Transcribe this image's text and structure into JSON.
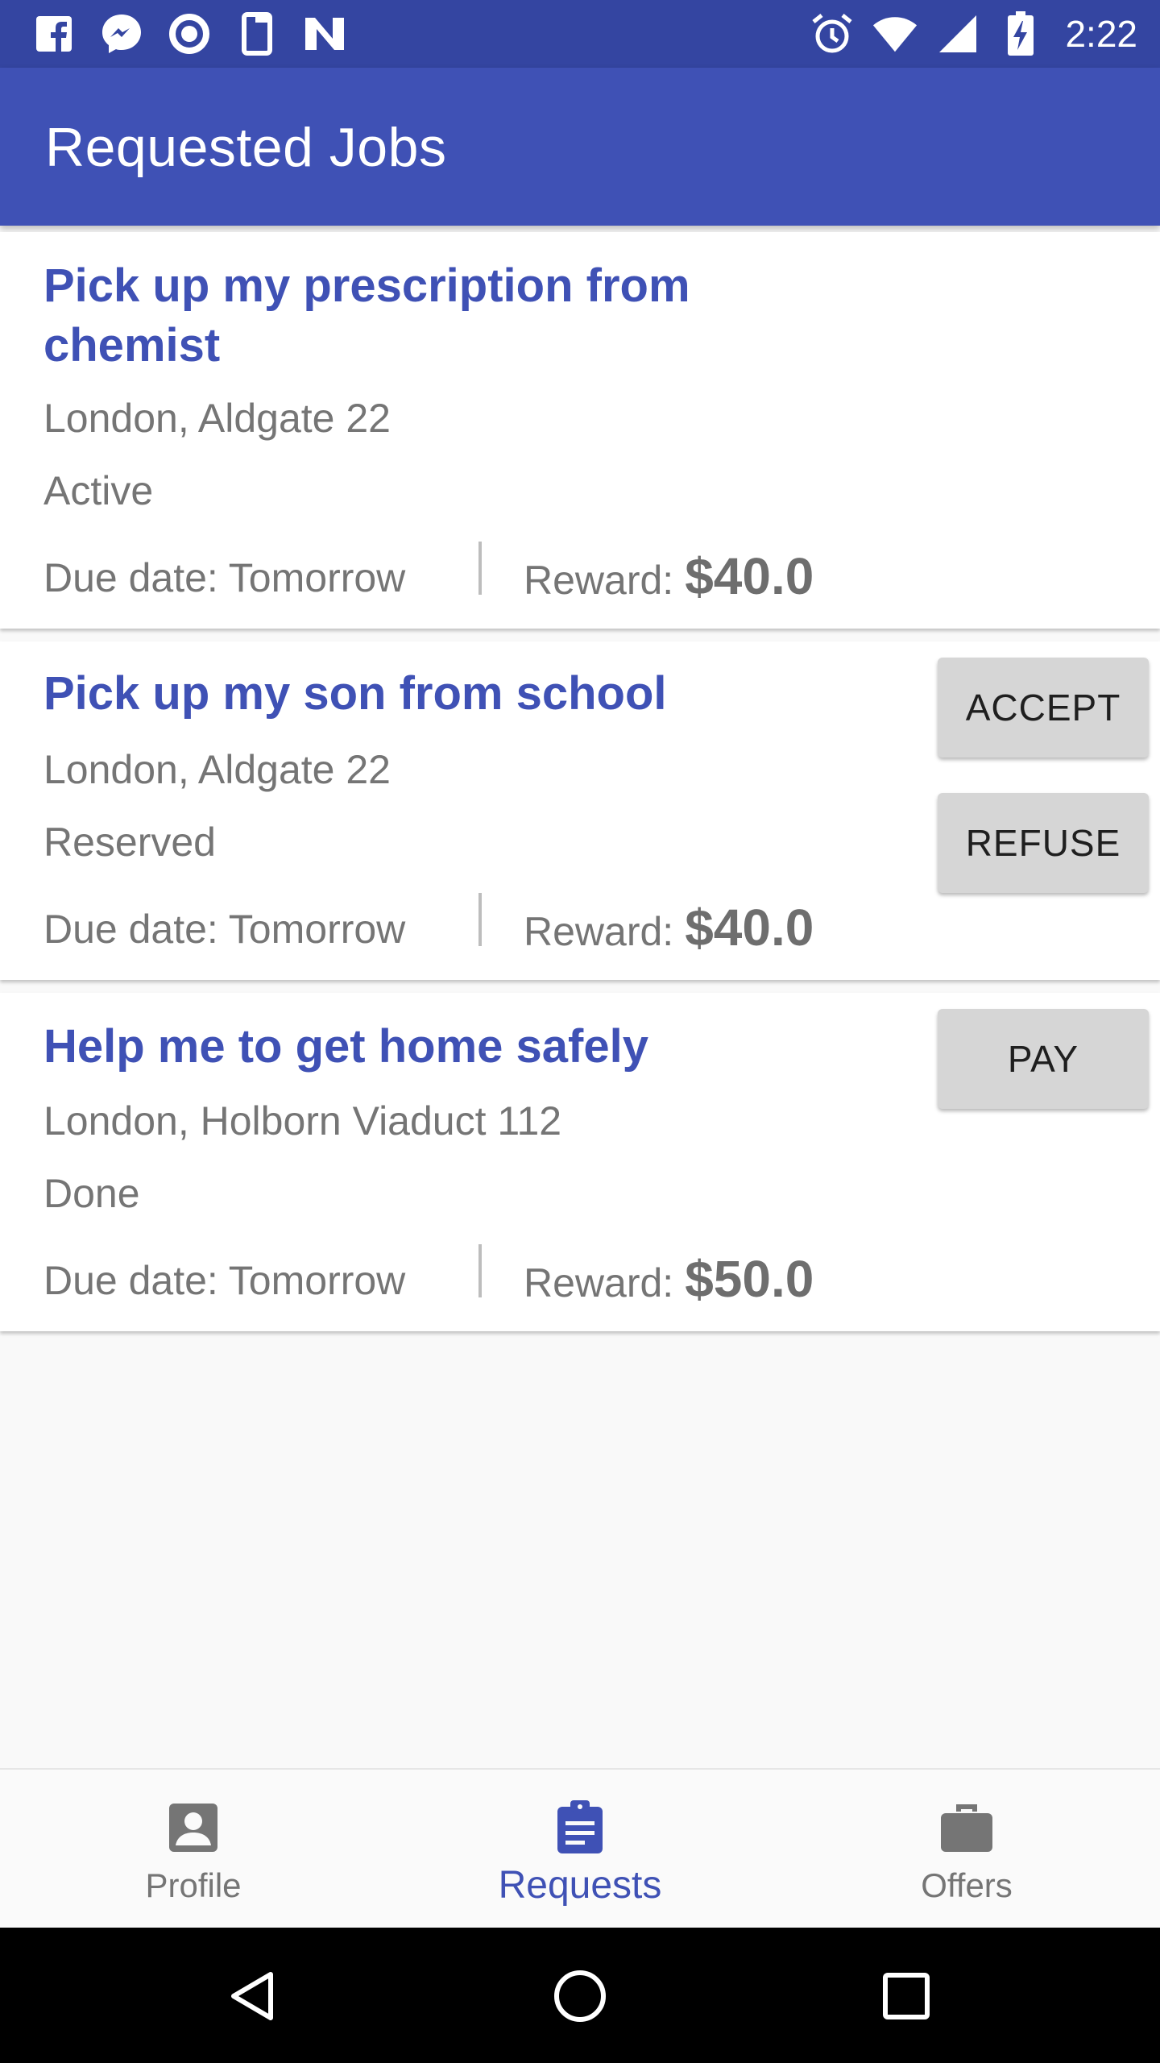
{
  "status_bar": {
    "time": "2:22",
    "left_icons": [
      "facebook-icon",
      "messenger-icon",
      "circle-app-icon",
      "phone-outline-icon",
      "n-app-icon"
    ],
    "right_icons": [
      "alarm-icon",
      "wifi-icon",
      "signal-icon",
      "battery-charging-icon"
    ]
  },
  "app_bar": {
    "title": "Requested Jobs"
  },
  "jobs": [
    {
      "title": "Pick up my prescription from chemist",
      "location": "London, Aldgate 22",
      "status": "Active",
      "due_label": "Due date: Tomorrow",
      "reward_label": "Reward:",
      "reward_value": "$40.0",
      "actions": []
    },
    {
      "title": "Pick up my son from school",
      "location": "London, Aldgate 22",
      "status": "Reserved",
      "due_label": "Due date: Tomorrow",
      "reward_label": "Reward:",
      "reward_value": "$40.0",
      "actions": [
        "ACCEPT",
        "REFUSE"
      ]
    },
    {
      "title": "Help me to get home safely",
      "location": "London, Holborn Viaduct 112",
      "status": "Done",
      "due_label": "Due date: Tomorrow",
      "reward_label": "Reward:",
      "reward_value": "$50.0",
      "actions": [
        "PAY"
      ]
    }
  ],
  "bottom_nav": {
    "items": [
      {
        "label": "Profile",
        "icon": "profile-icon",
        "active": false
      },
      {
        "label": "Requests",
        "icon": "clipboard-icon",
        "active": true
      },
      {
        "label": "Offers",
        "icon": "briefcase-icon",
        "active": false
      }
    ]
  },
  "colors": {
    "primary": "#3f51b5",
    "primary_dark": "#3445a1",
    "button_bg": "#d6d6d6",
    "secondary_text": "#757575"
  }
}
